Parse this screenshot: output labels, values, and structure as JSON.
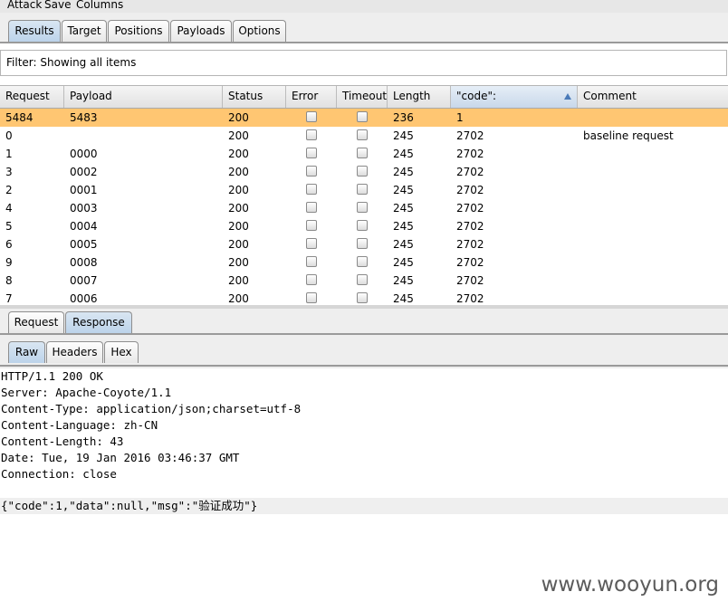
{
  "menu": [
    "Attack",
    "Save",
    "Columns"
  ],
  "main_tabs": [
    "Results",
    "Target",
    "Positions",
    "Payloads",
    "Options"
  ],
  "filter_text": "Filter: Showing all items",
  "table": {
    "columns": [
      "Request",
      "Payload",
      "Status",
      "Error",
      "Timeout",
      "Length",
      "\"code\":",
      "Comment"
    ],
    "rows": [
      {
        "request": "5484",
        "payload": "5483",
        "status": "200",
        "length": "236",
        "code": "1",
        "comment": ""
      },
      {
        "request": "0",
        "payload": "",
        "status": "200",
        "length": "245",
        "code": "2702",
        "comment": "baseline request"
      },
      {
        "request": "1",
        "payload": "0000",
        "status": "200",
        "length": "245",
        "code": "2702",
        "comment": ""
      },
      {
        "request": "3",
        "payload": "0002",
        "status": "200",
        "length": "245",
        "code": "2702",
        "comment": ""
      },
      {
        "request": "2",
        "payload": "0001",
        "status": "200",
        "length": "245",
        "code": "2702",
        "comment": ""
      },
      {
        "request": "4",
        "payload": "0003",
        "status": "200",
        "length": "245",
        "code": "2702",
        "comment": ""
      },
      {
        "request": "5",
        "payload": "0004",
        "status": "200",
        "length": "245",
        "code": "2702",
        "comment": ""
      },
      {
        "request": "6",
        "payload": "0005",
        "status": "200",
        "length": "245",
        "code": "2702",
        "comment": ""
      },
      {
        "request": "9",
        "payload": "0008",
        "status": "200",
        "length": "245",
        "code": "2702",
        "comment": ""
      },
      {
        "request": "8",
        "payload": "0007",
        "status": "200",
        "length": "245",
        "code": "2702",
        "comment": ""
      },
      {
        "request": "7",
        "payload": "0006",
        "status": "200",
        "length": "245",
        "code": "2702",
        "comment": ""
      }
    ]
  },
  "reqresp_tabs": [
    "Request",
    "Response"
  ],
  "view_tabs": [
    "Raw",
    "Headers",
    "Hex"
  ],
  "response_lines": [
    "HTTP/1.1 200 OK",
    "Server: Apache-Coyote/1.1",
    "Content-Type: application/json;charset=utf-8",
    "Content-Language: zh-CN",
    "Content-Length: 43",
    "Date: Tue, 19 Jan 2016 03:46:37 GMT",
    "Connection: close"
  ],
  "response_body": "{\"code\":1,\"data\":null,\"msg\":\"验证成功\"}",
  "watermark": "www.wooyun.org",
  "colors": {
    "selected_row": "#ffc672",
    "active_tab": "#bcd3ea"
  }
}
